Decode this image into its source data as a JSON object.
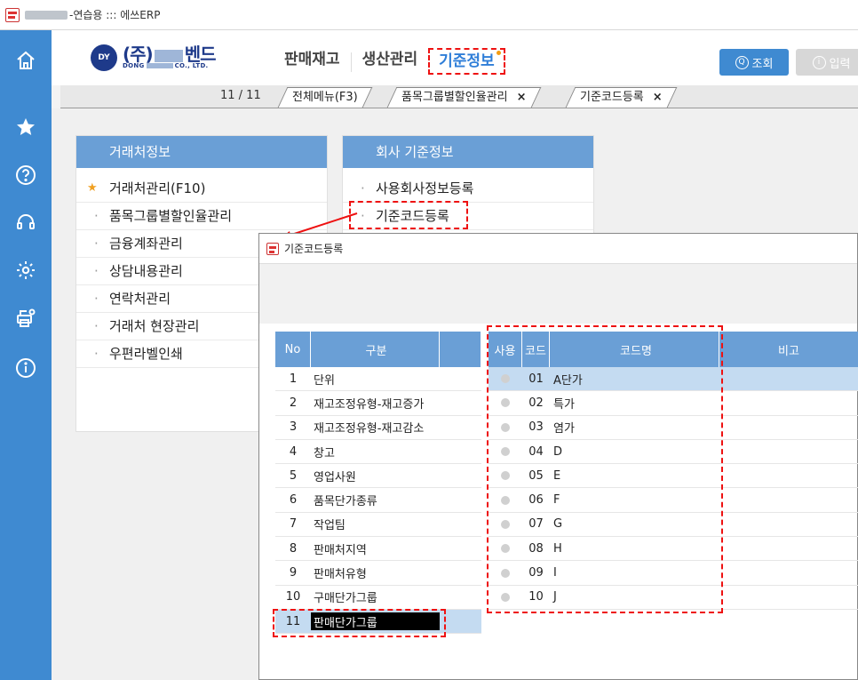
{
  "window": {
    "title": "-연습용 ::: 에쓰ERP"
  },
  "brand": {
    "prefix": "(주)",
    "name_mid": "벤드",
    "sub_left": "DONG",
    "sub_right": "CO., LTD.",
    "mark": "DY"
  },
  "topnav": [
    {
      "label": "판매재고"
    },
    {
      "label": "생산관리"
    },
    {
      "label": "기준정보",
      "active": true
    }
  ],
  "toolbar": {
    "query_label": "조회",
    "input_label": "입력"
  },
  "tabs": {
    "count": "11 / 11",
    "items": [
      {
        "label": "전체메뉴(F3)"
      },
      {
        "label": "품목그룹별할인율관리",
        "close": "×"
      },
      {
        "label": "기준코드등록",
        "close": "×"
      }
    ]
  },
  "card_partner": {
    "title": "거래처정보",
    "items": [
      "거래처관리(F10)",
      "품목그룹별할인율관리",
      "금융계좌관리",
      "상담내용관리",
      "연락처관리",
      "거래처 현장관리",
      "우편라벨인쇄"
    ]
  },
  "card_company": {
    "title": "회사 기준정보",
    "items": [
      "사용회사정보등록",
      "기준코드등록"
    ]
  },
  "inner_window": {
    "title": "기준코드등록",
    "left_grid": {
      "headers": [
        "No",
        "구분"
      ],
      "rows": [
        [
          "1",
          "단위"
        ],
        [
          "2",
          "재고조정유형-재고증가"
        ],
        [
          "3",
          "재고조정유형-재고감소"
        ],
        [
          "4",
          "창고"
        ],
        [
          "5",
          "영업사원"
        ],
        [
          "6",
          "품목단가종류"
        ],
        [
          "7",
          "작업팀"
        ],
        [
          "8",
          "판매처지역"
        ],
        [
          "9",
          "판매처유형"
        ],
        [
          "10",
          "구매단가그룹"
        ],
        [
          "11",
          "판매단가그룹"
        ]
      ]
    },
    "right_grid": {
      "headers": [
        "사용",
        "코드",
        "코드명",
        "비고"
      ],
      "rows": [
        [
          "01",
          "A단가"
        ],
        [
          "02",
          "특가"
        ],
        [
          "03",
          "염가"
        ],
        [
          "04",
          "D"
        ],
        [
          "05",
          "E"
        ],
        [
          "06",
          "F"
        ],
        [
          "07",
          "G"
        ],
        [
          "08",
          "H"
        ],
        [
          "09",
          "I"
        ],
        [
          "10",
          "J"
        ]
      ]
    }
  }
}
